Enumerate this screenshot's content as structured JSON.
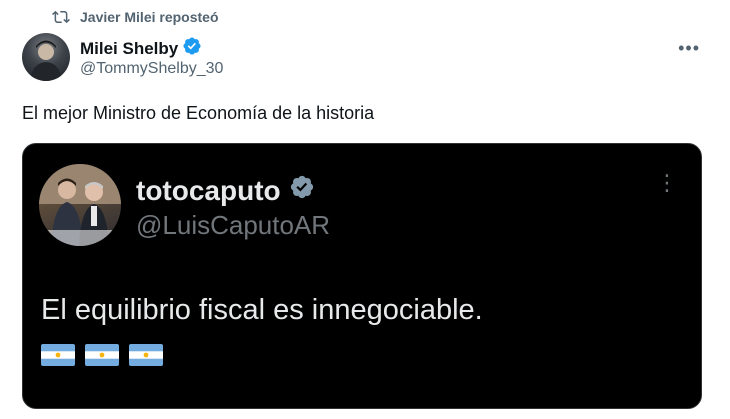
{
  "repost": {
    "icon": "repost-icon",
    "text": "Javier Milei reposteó"
  },
  "post": {
    "author_name": "Milei Shelby",
    "author_handle": "@TommyShelby_30",
    "verified_icon": "verified-badge-icon",
    "more_label": "•••",
    "text": "El mejor Ministro de Economía de la historia"
  },
  "quoted": {
    "author_name": "totocaputo",
    "author_handle": "@LuisCaputoAR",
    "verified_icon": "verified-badge-gray-icon",
    "more_label": "⋮",
    "text": "El equilibrio fiscal es innegociable.",
    "flags": [
      "argentina-flag-icon",
      "argentina-flag-icon",
      "argentina-flag-icon"
    ]
  },
  "colors": {
    "verified_blue": "#1d9bf0",
    "quote_bg": "#000000",
    "secondary_text": "#536471"
  }
}
